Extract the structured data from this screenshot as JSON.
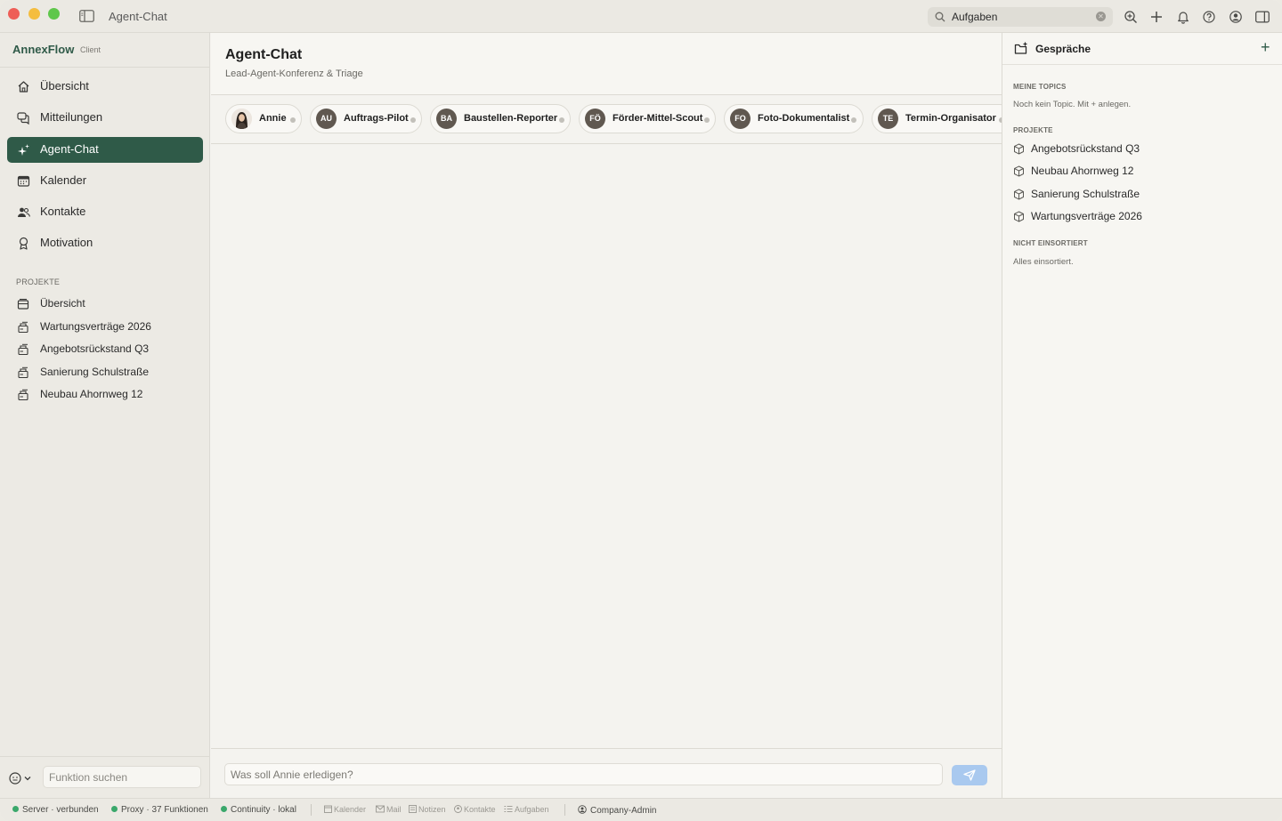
{
  "window": {
    "title": "Agent-Chat"
  },
  "toolbar": {
    "search_value": "Aufgaben"
  },
  "brand": {
    "name": "AnnexFlow",
    "sub": "Client"
  },
  "sidebar": {
    "nav": [
      {
        "label": "Übersicht",
        "icon": "home-icon"
      },
      {
        "label": "Mitteilungen",
        "icon": "messages-icon"
      },
      {
        "label": "Agent-Chat",
        "icon": "sparkle-icon",
        "active": true
      },
      {
        "label": "Kalender",
        "icon": "calendar-icon"
      },
      {
        "label": "Kontakte",
        "icon": "contacts-icon"
      },
      {
        "label": "Motivation",
        "icon": "award-icon"
      }
    ],
    "projects_label": "PROJEKTE",
    "projects": [
      {
        "label": "Übersicht"
      },
      {
        "label": "Wartungsverträge 2026"
      },
      {
        "label": "Angebotsrückstand Q3"
      },
      {
        "label": "Sanierung Schulstraße"
      },
      {
        "label": "Neubau Ahornweg 12"
      }
    ],
    "function_search_placeholder": "Funktion suchen"
  },
  "main": {
    "title": "Agent-Chat",
    "subtitle": "Lead-Agent-Konferenz & Triage",
    "agents": [
      {
        "initials": "",
        "name": "Annie",
        "photo": true
      },
      {
        "initials": "AU",
        "name": "Auftrags-Pilot"
      },
      {
        "initials": "BA",
        "name": "Baustellen-Reporter"
      },
      {
        "initials": "FÖ",
        "name": "Förder-Mittel-Scout"
      },
      {
        "initials": "FO",
        "name": "Foto-Dokumentalist"
      },
      {
        "initials": "TE",
        "name": "Termin-Organisator"
      }
    ],
    "composer_placeholder": "Was soll Annie erledigen?"
  },
  "right_panel": {
    "title": "Gespräche",
    "my_topics_label": "MEINE TOPICS",
    "my_topics_note": "Noch kein Topic. Mit + anlegen.",
    "projects_label": "PROJEKTE",
    "projects": [
      {
        "label": "Angebotsrückstand Q3"
      },
      {
        "label": "Neubau Ahornweg 12"
      },
      {
        "label": "Sanierung Schulstraße"
      },
      {
        "label": "Wartungsverträge 2026"
      }
    ],
    "unsorted_label": "NICHT EINSORTIERT",
    "unsorted_note": "Alles einsortiert."
  },
  "statusbar": {
    "server": "Server · verbunden",
    "proxy": "Proxy · 37 Funktionen",
    "continuity": "Continuity · lokal",
    "shortcuts": [
      "Kalender",
      "Mail",
      "Notizen",
      "Kontakte",
      "Aufgaben"
    ],
    "user": "Company-Admin"
  },
  "colors": {
    "accent": "#2f5a48",
    "status_ok": "#3aa86b",
    "send": "#a9c9ef"
  }
}
